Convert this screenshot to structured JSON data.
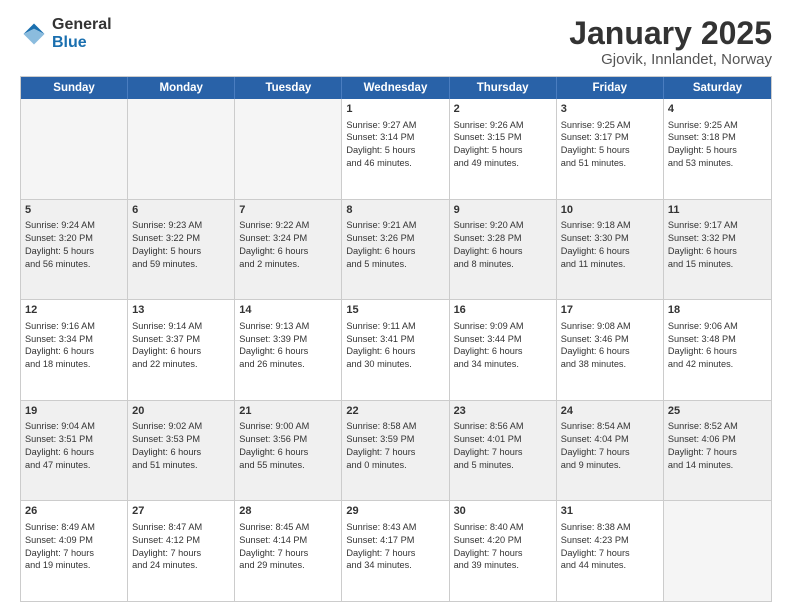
{
  "logo": {
    "general": "General",
    "blue": "Blue"
  },
  "title": "January 2025",
  "subtitle": "Gjovik, Innlandet, Norway",
  "days": [
    "Sunday",
    "Monday",
    "Tuesday",
    "Wednesday",
    "Thursday",
    "Friday",
    "Saturday"
  ],
  "rows": [
    [
      {
        "day": "",
        "empty": true
      },
      {
        "day": "",
        "empty": true
      },
      {
        "day": "",
        "empty": true
      },
      {
        "day": "1",
        "line1": "Sunrise: 9:27 AM",
        "line2": "Sunset: 3:14 PM",
        "line3": "Daylight: 5 hours",
        "line4": "and 46 minutes."
      },
      {
        "day": "2",
        "line1": "Sunrise: 9:26 AM",
        "line2": "Sunset: 3:15 PM",
        "line3": "Daylight: 5 hours",
        "line4": "and 49 minutes."
      },
      {
        "day": "3",
        "line1": "Sunrise: 9:25 AM",
        "line2": "Sunset: 3:17 PM",
        "line3": "Daylight: 5 hours",
        "line4": "and 51 minutes."
      },
      {
        "day": "4",
        "line1": "Sunrise: 9:25 AM",
        "line2": "Sunset: 3:18 PM",
        "line3": "Daylight: 5 hours",
        "line4": "and 53 minutes."
      }
    ],
    [
      {
        "day": "5",
        "line1": "Sunrise: 9:24 AM",
        "line2": "Sunset: 3:20 PM",
        "line3": "Daylight: 5 hours",
        "line4": "and 56 minutes."
      },
      {
        "day": "6",
        "line1": "Sunrise: 9:23 AM",
        "line2": "Sunset: 3:22 PM",
        "line3": "Daylight: 5 hours",
        "line4": "and 59 minutes."
      },
      {
        "day": "7",
        "line1": "Sunrise: 9:22 AM",
        "line2": "Sunset: 3:24 PM",
        "line3": "Daylight: 6 hours",
        "line4": "and 2 minutes."
      },
      {
        "day": "8",
        "line1": "Sunrise: 9:21 AM",
        "line2": "Sunset: 3:26 PM",
        "line3": "Daylight: 6 hours",
        "line4": "and 5 minutes."
      },
      {
        "day": "9",
        "line1": "Sunrise: 9:20 AM",
        "line2": "Sunset: 3:28 PM",
        "line3": "Daylight: 6 hours",
        "line4": "and 8 minutes."
      },
      {
        "day": "10",
        "line1": "Sunrise: 9:18 AM",
        "line2": "Sunset: 3:30 PM",
        "line3": "Daylight: 6 hours",
        "line4": "and 11 minutes."
      },
      {
        "day": "11",
        "line1": "Sunrise: 9:17 AM",
        "line2": "Sunset: 3:32 PM",
        "line3": "Daylight: 6 hours",
        "line4": "and 15 minutes."
      }
    ],
    [
      {
        "day": "12",
        "line1": "Sunrise: 9:16 AM",
        "line2": "Sunset: 3:34 PM",
        "line3": "Daylight: 6 hours",
        "line4": "and 18 minutes."
      },
      {
        "day": "13",
        "line1": "Sunrise: 9:14 AM",
        "line2": "Sunset: 3:37 PM",
        "line3": "Daylight: 6 hours",
        "line4": "and 22 minutes."
      },
      {
        "day": "14",
        "line1": "Sunrise: 9:13 AM",
        "line2": "Sunset: 3:39 PM",
        "line3": "Daylight: 6 hours",
        "line4": "and 26 minutes."
      },
      {
        "day": "15",
        "line1": "Sunrise: 9:11 AM",
        "line2": "Sunset: 3:41 PM",
        "line3": "Daylight: 6 hours",
        "line4": "and 30 minutes."
      },
      {
        "day": "16",
        "line1": "Sunrise: 9:09 AM",
        "line2": "Sunset: 3:44 PM",
        "line3": "Daylight: 6 hours",
        "line4": "and 34 minutes."
      },
      {
        "day": "17",
        "line1": "Sunrise: 9:08 AM",
        "line2": "Sunset: 3:46 PM",
        "line3": "Daylight: 6 hours",
        "line4": "and 38 minutes."
      },
      {
        "day": "18",
        "line1": "Sunrise: 9:06 AM",
        "line2": "Sunset: 3:48 PM",
        "line3": "Daylight: 6 hours",
        "line4": "and 42 minutes."
      }
    ],
    [
      {
        "day": "19",
        "line1": "Sunrise: 9:04 AM",
        "line2": "Sunset: 3:51 PM",
        "line3": "Daylight: 6 hours",
        "line4": "and 47 minutes."
      },
      {
        "day": "20",
        "line1": "Sunrise: 9:02 AM",
        "line2": "Sunset: 3:53 PM",
        "line3": "Daylight: 6 hours",
        "line4": "and 51 minutes."
      },
      {
        "day": "21",
        "line1": "Sunrise: 9:00 AM",
        "line2": "Sunset: 3:56 PM",
        "line3": "Daylight: 6 hours",
        "line4": "and 55 minutes."
      },
      {
        "day": "22",
        "line1": "Sunrise: 8:58 AM",
        "line2": "Sunset: 3:59 PM",
        "line3": "Daylight: 7 hours",
        "line4": "and 0 minutes."
      },
      {
        "day": "23",
        "line1": "Sunrise: 8:56 AM",
        "line2": "Sunset: 4:01 PM",
        "line3": "Daylight: 7 hours",
        "line4": "and 5 minutes."
      },
      {
        "day": "24",
        "line1": "Sunrise: 8:54 AM",
        "line2": "Sunset: 4:04 PM",
        "line3": "Daylight: 7 hours",
        "line4": "and 9 minutes."
      },
      {
        "day": "25",
        "line1": "Sunrise: 8:52 AM",
        "line2": "Sunset: 4:06 PM",
        "line3": "Daylight: 7 hours",
        "line4": "and 14 minutes."
      }
    ],
    [
      {
        "day": "26",
        "line1": "Sunrise: 8:49 AM",
        "line2": "Sunset: 4:09 PM",
        "line3": "Daylight: 7 hours",
        "line4": "and 19 minutes."
      },
      {
        "day": "27",
        "line1": "Sunrise: 8:47 AM",
        "line2": "Sunset: 4:12 PM",
        "line3": "Daylight: 7 hours",
        "line4": "and 24 minutes."
      },
      {
        "day": "28",
        "line1": "Sunrise: 8:45 AM",
        "line2": "Sunset: 4:14 PM",
        "line3": "Daylight: 7 hours",
        "line4": "and 29 minutes."
      },
      {
        "day": "29",
        "line1": "Sunrise: 8:43 AM",
        "line2": "Sunset: 4:17 PM",
        "line3": "Daylight: 7 hours",
        "line4": "and 34 minutes."
      },
      {
        "day": "30",
        "line1": "Sunrise: 8:40 AM",
        "line2": "Sunset: 4:20 PM",
        "line3": "Daylight: 7 hours",
        "line4": "and 39 minutes."
      },
      {
        "day": "31",
        "line1": "Sunrise: 8:38 AM",
        "line2": "Sunset: 4:23 PM",
        "line3": "Daylight: 7 hours",
        "line4": "and 44 minutes."
      },
      {
        "day": "",
        "empty": true
      }
    ]
  ]
}
